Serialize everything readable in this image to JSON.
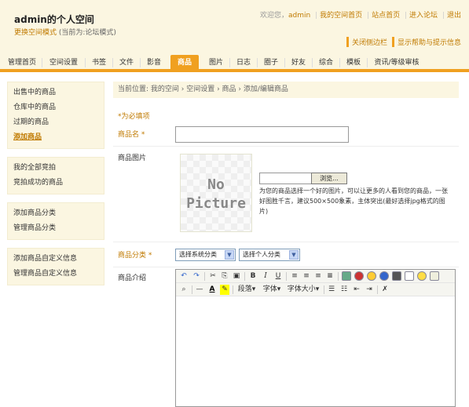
{
  "header": {
    "space_title": "admin的个人空间",
    "mode_switch": "更换空间模式",
    "mode_current": "(当前为:论坛模式)",
    "welcome": "欢迎您，",
    "username": "admin",
    "links": [
      "我的空间首页",
      "站点首页",
      "进入论坛",
      "退出"
    ],
    "tools": [
      "关闭侧边栏",
      "显示帮助与提示信息"
    ]
  },
  "nav": {
    "tabs": [
      "管理首页",
      "空间设置",
      "书签",
      "文件",
      "影音",
      "商品",
      "图片",
      "日志",
      "圈子",
      "好友",
      "综合",
      "模板",
      "资讯/等级审核"
    ],
    "active": "商品"
  },
  "sidebar": {
    "group1": [
      "出售中的商品",
      "仓库中的商品",
      "过期的商品",
      "添加商品"
    ],
    "group2": [
      "我的全部竞拍",
      "竞拍成功的商品"
    ],
    "group3": [
      "添加商品分类",
      "管理商品分类"
    ],
    "group4": [
      "添加商品自定义信息",
      "管理商品自定义信息"
    ]
  },
  "breadcrumb": "当前位置: 我的空间 › 空间设置 › 商品 › 添加/编辑商品",
  "form": {
    "required_note": "*为必填项",
    "name_label": "商品名 *",
    "image_label": "商品图片",
    "no_picture_1": "No",
    "no_picture_2": "Picture",
    "browse": "浏览...",
    "image_hint": "为您的商品选择一个好的图片，可以让更多的人看到您的商品，一张好图胜千言，建议500×500象素，主体突出(最好选择jpg格式的图片)",
    "category_label": "商品分类 *",
    "system_category": "选择系统分类",
    "personal_category": "选择个人分类",
    "intro_label": "商品介绍"
  },
  "editor": {
    "row2": [
      "段落▾",
      "字体▾",
      "字体大小▾"
    ],
    "icons": [
      "undo-icon",
      "redo-icon",
      "cut-icon",
      "copy-icon",
      "paste-icon",
      "bold-icon",
      "italic-icon",
      "underline-icon",
      "align-left-icon",
      "align-center-icon",
      "align-right-icon",
      "justify-icon",
      "image-icon",
      "flash-icon",
      "media-icon",
      "link-icon",
      "emoticon-icon"
    ]
  },
  "colors": {
    "accent": "#f0a020",
    "panel": "#fbf6e1",
    "link": "#c07a00"
  }
}
